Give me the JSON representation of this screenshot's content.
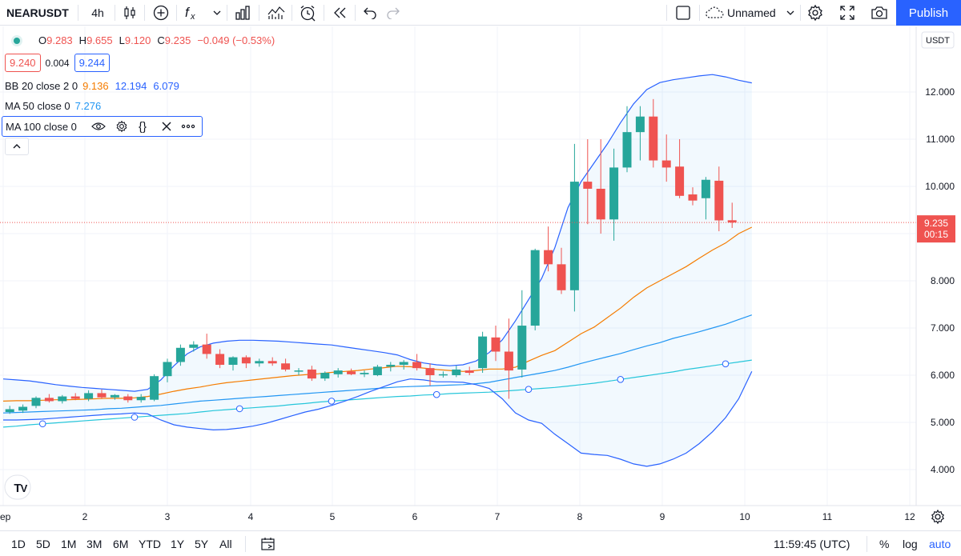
{
  "toolbar": {
    "symbol": "NEARUSDT",
    "interval": "4h",
    "layout_name": "Unnamed",
    "publish_label": "Publish"
  },
  "legend": {
    "ohlc": {
      "o_label": "O",
      "o": "9.283",
      "h_label": "H",
      "h": "9.655",
      "l_label": "L",
      "l": "9.120",
      "c_label": "C",
      "c": "9.235",
      "change": "−0.049 (−0.53%)"
    },
    "bid": "9.240",
    "spread": "0.004",
    "ask": "9.244",
    "indicators": [
      {
        "name": "BB 20 close 2 0",
        "values": [
          "9.136",
          "12.194",
          "6.079"
        ],
        "colors": [
          "#f57c00",
          "#2962ff",
          "#2962ff"
        ]
      },
      {
        "name": "MA 50 close 0",
        "values": [
          "7.276"
        ],
        "colors": [
          "#2196f3"
        ]
      },
      {
        "name": "MA 100 close 0",
        "values": []
      }
    ]
  },
  "price_axis": {
    "currency": "USDT",
    "last_price": "9.235",
    "countdown": "00:15",
    "ticks": [
      "4.000",
      "5.000",
      "6.000",
      "7.000",
      "8.000",
      "9.000",
      "10.000",
      "11.000",
      "12.000"
    ]
  },
  "time_axis": {
    "ticks": [
      "Sep",
      "2",
      "3",
      "4",
      "5",
      "6",
      "7",
      "8",
      "9",
      "10",
      "11",
      "12"
    ]
  },
  "bottom": {
    "ranges": [
      "1D",
      "5D",
      "1M",
      "3M",
      "6M",
      "YTD",
      "1Y",
      "5Y",
      "All"
    ],
    "clock": "11:59:45 (UTC)",
    "percent": "%",
    "log": "log",
    "auto": "auto"
  },
  "colors": {
    "up": "#26a69a",
    "down": "#ef5350",
    "bb_band": "#2962ff",
    "bb_basis": "#f57c00",
    "ma50": "#2196f3",
    "ma100": "#26c6da",
    "accent": "#2962ff"
  },
  "chart_data": {
    "type": "candlestick",
    "symbol": "NEARUSDT",
    "interval": "4h",
    "ylim": [
      3.55,
      13.3
    ],
    "x_ticks": [
      "Sep",
      "2",
      "3",
      "4",
      "5",
      "6",
      "7",
      "8",
      "9",
      "10",
      "11",
      "12"
    ],
    "candles": [
      {
        "o": 5.22,
        "h": 5.35,
        "l": 5.18,
        "c": 5.28
      },
      {
        "o": 5.25,
        "h": 5.38,
        "l": 5.2,
        "c": 5.33
      },
      {
        "o": 5.35,
        "h": 5.55,
        "l": 5.3,
        "c": 5.52
      },
      {
        "o": 5.52,
        "h": 5.6,
        "l": 5.42,
        "c": 5.45
      },
      {
        "o": 5.45,
        "h": 5.58,
        "l": 5.4,
        "c": 5.55
      },
      {
        "o": 5.55,
        "h": 5.62,
        "l": 5.47,
        "c": 5.5
      },
      {
        "o": 5.5,
        "h": 5.68,
        "l": 5.45,
        "c": 5.62
      },
      {
        "o": 5.62,
        "h": 5.7,
        "l": 5.5,
        "c": 5.53
      },
      {
        "o": 5.53,
        "h": 5.6,
        "l": 5.48,
        "c": 5.58
      },
      {
        "o": 5.55,
        "h": 5.6,
        "l": 5.42,
        "c": 5.47
      },
      {
        "o": 5.47,
        "h": 5.6,
        "l": 5.42,
        "c": 5.54
      },
      {
        "o": 5.48,
        "h": 6.02,
        "l": 5.45,
        "c": 5.98
      },
      {
        "o": 5.98,
        "h": 6.35,
        "l": 5.85,
        "c": 6.28
      },
      {
        "o": 6.28,
        "h": 6.65,
        "l": 6.2,
        "c": 6.58
      },
      {
        "o": 6.58,
        "h": 6.72,
        "l": 6.5,
        "c": 6.65
      },
      {
        "o": 6.65,
        "h": 6.88,
        "l": 6.35,
        "c": 6.45
      },
      {
        "o": 6.45,
        "h": 6.55,
        "l": 6.15,
        "c": 6.22
      },
      {
        "o": 6.22,
        "h": 6.4,
        "l": 6.1,
        "c": 6.38
      },
      {
        "o": 6.38,
        "h": 6.42,
        "l": 6.15,
        "c": 6.25
      },
      {
        "o": 6.25,
        "h": 6.35,
        "l": 6.18,
        "c": 6.3
      },
      {
        "o": 6.3,
        "h": 6.38,
        "l": 6.2,
        "c": 6.25
      },
      {
        "o": 6.25,
        "h": 6.35,
        "l": 6.08,
        "c": 6.12
      },
      {
        "o": 6.08,
        "h": 6.15,
        "l": 6.0,
        "c": 6.1
      },
      {
        "o": 6.12,
        "h": 6.2,
        "l": 5.88,
        "c": 5.93
      },
      {
        "o": 5.93,
        "h": 6.08,
        "l": 5.88,
        "c": 6.05
      },
      {
        "o": 6.02,
        "h": 6.15,
        "l": 5.95,
        "c": 6.1
      },
      {
        "o": 6.08,
        "h": 6.14,
        "l": 6.0,
        "c": 6.02
      },
      {
        "o": 6.02,
        "h": 6.1,
        "l": 5.96,
        "c": 6.05
      },
      {
        "o": 6.0,
        "h": 6.22,
        "l": 5.98,
        "c": 6.18
      },
      {
        "o": 6.18,
        "h": 6.28,
        "l": 6.08,
        "c": 6.22
      },
      {
        "o": 6.22,
        "h": 6.32,
        "l": 6.12,
        "c": 6.28
      },
      {
        "o": 6.28,
        "h": 6.45,
        "l": 6.1,
        "c": 6.15
      },
      {
        "o": 6.15,
        "h": 6.25,
        "l": 5.78,
        "c": 6.0
      },
      {
        "o": 6.0,
        "h": 6.08,
        "l": 5.95,
        "c": 6.02
      },
      {
        "o": 6.0,
        "h": 6.2,
        "l": 5.96,
        "c": 6.12
      },
      {
        "o": 6.1,
        "h": 6.18,
        "l": 6.0,
        "c": 6.05
      },
      {
        "o": 6.15,
        "h": 6.92,
        "l": 6.05,
        "c": 6.82
      },
      {
        "o": 6.8,
        "h": 7.05,
        "l": 6.3,
        "c": 6.5
      },
      {
        "o": 6.5,
        "h": 7.2,
        "l": 5.5,
        "c": 6.1
      },
      {
        "o": 6.12,
        "h": 7.8,
        "l": 5.95,
        "c": 7.05
      },
      {
        "o": 7.05,
        "h": 8.68,
        "l": 6.95,
        "c": 8.65
      },
      {
        "o": 8.65,
        "h": 9.15,
        "l": 8.2,
        "c": 8.35
      },
      {
        "o": 8.35,
        "h": 8.7,
        "l": 7.72,
        "c": 7.8
      },
      {
        "o": 7.8,
        "h": 10.9,
        "l": 7.35,
        "c": 10.1
      },
      {
        "o": 10.1,
        "h": 11.0,
        "l": 9.2,
        "c": 9.95
      },
      {
        "o": 9.95,
        "h": 11.0,
        "l": 9.0,
        "c": 9.3
      },
      {
        "o": 9.3,
        "h": 10.8,
        "l": 8.85,
        "c": 10.4
      },
      {
        "o": 10.4,
        "h": 11.7,
        "l": 10.3,
        "c": 11.15
      },
      {
        "o": 11.15,
        "h": 11.7,
        "l": 10.55,
        "c": 11.48
      },
      {
        "o": 11.48,
        "h": 11.85,
        "l": 10.4,
        "c": 10.55
      },
      {
        "o": 10.55,
        "h": 11.1,
        "l": 10.1,
        "c": 10.4
      },
      {
        "o": 10.42,
        "h": 11.0,
        "l": 9.75,
        "c": 9.8
      },
      {
        "o": 9.83,
        "h": 9.98,
        "l": 9.6,
        "c": 9.7
      },
      {
        "o": 9.75,
        "h": 10.2,
        "l": 9.3,
        "c": 10.14
      },
      {
        "o": 10.12,
        "h": 10.42,
        "l": 9.05,
        "c": 9.28
      },
      {
        "o": 9.283,
        "h": 9.655,
        "l": 9.12,
        "c": 9.235
      }
    ],
    "series": [
      {
        "name": "BB 20 close 2 0 basis",
        "values": [
          5.45,
          5.46,
          5.46,
          5.47,
          5.48,
          5.48,
          5.49,
          5.5,
          5.51,
          5.51,
          5.52,
          5.55,
          5.6,
          5.66,
          5.71,
          5.75,
          5.8,
          5.84,
          5.87,
          5.9,
          5.93,
          5.96,
          5.99,
          6.01,
          6.03,
          6.06,
          6.08,
          6.1,
          6.13,
          6.16,
          6.19,
          6.18,
          6.15,
          6.12,
          6.1,
          6.08,
          6.1,
          6.13,
          6.13,
          6.17,
          6.3,
          6.42,
          6.52,
          6.7,
          6.88,
          7.02,
          7.22,
          7.42,
          7.65,
          7.85,
          8.0,
          8.15,
          8.3,
          8.48,
          8.65,
          8.8,
          9.0,
          9.136
        ]
      },
      {
        "name": "BB 20 close 2 0 upper",
        "values": [
          5.92,
          5.9,
          5.88,
          5.84,
          5.8,
          5.77,
          5.74,
          5.72,
          5.7,
          5.68,
          5.66,
          5.7,
          5.9,
          6.2,
          6.45,
          6.6,
          6.68,
          6.72,
          6.74,
          6.74,
          6.73,
          6.72,
          6.7,
          6.68,
          6.66,
          6.64,
          6.6,
          6.56,
          6.52,
          6.48,
          6.43,
          6.33,
          6.26,
          6.22,
          6.2,
          6.22,
          6.3,
          6.48,
          6.75,
          7.15,
          7.6,
          8.05,
          8.7,
          9.55,
          10.1,
          10.5,
          10.9,
          11.35,
          11.75,
          12.05,
          12.2,
          12.26,
          12.3,
          12.34,
          12.37,
          12.32,
          12.25,
          12.194
        ]
      },
      {
        "name": "BB 20 close 2 0 lower",
        "values": [
          5.05,
          5.05,
          5.06,
          5.07,
          5.09,
          5.11,
          5.13,
          5.15,
          5.17,
          5.18,
          5.2,
          5.18,
          5.05,
          4.95,
          4.9,
          4.87,
          4.84,
          4.85,
          4.88,
          4.92,
          4.98,
          5.06,
          5.14,
          5.22,
          5.28,
          5.36,
          5.45,
          5.55,
          5.66,
          5.76,
          5.86,
          5.92,
          5.9,
          5.86,
          5.86,
          5.85,
          5.8,
          5.72,
          5.5,
          5.2,
          5.05,
          4.98,
          4.75,
          4.55,
          4.35,
          4.32,
          4.3,
          4.22,
          4.12,
          4.07,
          4.12,
          4.22,
          4.35,
          4.55,
          4.8,
          5.1,
          5.5,
          6.079
        ]
      },
      {
        "name": "MA 50 close 0",
        "values": [
          5.2,
          5.21,
          5.22,
          5.23,
          5.24,
          5.25,
          5.26,
          5.27,
          5.29,
          5.3,
          5.32,
          5.34,
          5.36,
          5.39,
          5.42,
          5.45,
          5.47,
          5.49,
          5.51,
          5.53,
          5.55,
          5.57,
          5.59,
          5.61,
          5.63,
          5.65,
          5.67,
          5.69,
          5.71,
          5.73,
          5.75,
          5.76,
          5.77,
          5.78,
          5.79,
          5.8,
          5.82,
          5.85,
          5.9,
          5.95,
          6.0,
          6.05,
          6.1,
          6.17,
          6.25,
          6.32,
          6.39,
          6.46,
          6.54,
          6.62,
          6.69,
          6.78,
          6.85,
          6.92,
          7.0,
          7.08,
          7.18,
          7.276
        ]
      },
      {
        "name": "MA 100 close 0",
        "values": [
          4.9,
          4.92,
          4.95,
          4.97,
          4.99,
          5.01,
          5.03,
          5.05,
          5.07,
          5.09,
          5.11,
          5.13,
          5.15,
          5.17,
          5.19,
          5.22,
          5.25,
          5.27,
          5.29,
          5.31,
          5.33,
          5.35,
          5.38,
          5.4,
          5.43,
          5.45,
          5.47,
          5.49,
          5.51,
          5.53,
          5.55,
          5.56,
          5.58,
          5.59,
          5.61,
          5.62,
          5.63,
          5.64,
          5.66,
          5.68,
          5.7,
          5.72,
          5.74,
          5.77,
          5.8,
          5.83,
          5.87,
          5.91,
          5.95,
          5.99,
          6.03,
          6.07,
          6.12,
          6.16,
          6.2,
          6.24,
          6.28,
          6.32
        ]
      }
    ]
  }
}
